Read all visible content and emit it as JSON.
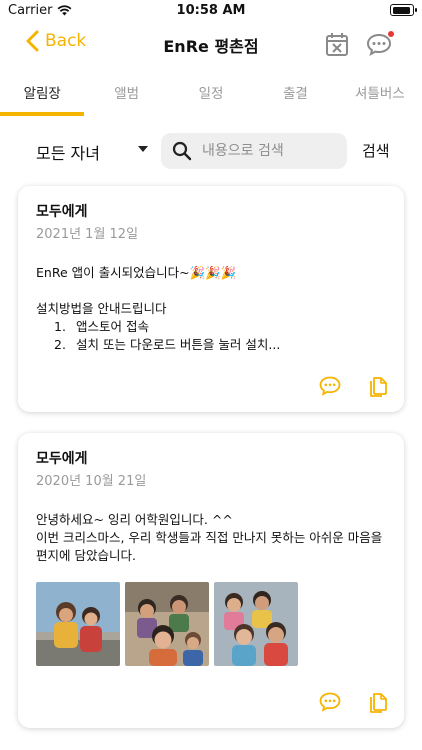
{
  "status_bar": {
    "carrier": "Carrier",
    "time": "10:58 AM",
    "battery_level": 0.95
  },
  "nav": {
    "back_label": "Back",
    "title": "EnRe 평촌점",
    "icons": [
      "calendar-x-icon",
      "chat-bubble-icon"
    ],
    "has_notification": true
  },
  "tabs": [
    {
      "label": "알림장",
      "active": true
    },
    {
      "label": "앨범",
      "active": false
    },
    {
      "label": "일정",
      "active": false
    },
    {
      "label": "출결",
      "active": false
    },
    {
      "label": "셔틀버스",
      "active": false
    }
  ],
  "filter": {
    "child_selected": "모든 자녀",
    "search_placeholder": "내용으로 검색",
    "search_button": "검색"
  },
  "notices": [
    {
      "to": "모두에게",
      "date": "2021년 1월 12일",
      "line1": "EnRe 앱이 출시되었습니다~🎉🎉🎉",
      "line2": "설치방법을 안내드립니다",
      "list": [
        {
          "num": "1.",
          "text": "앱스토어 접속"
        },
        {
          "num": "2.",
          "text": "설치 또는 다운로드 버튼을 눌러 설치..."
        }
      ]
    },
    {
      "to": "모두에게",
      "date": "2020년 10월 21일",
      "line1": "안녕하세요~ 잉리 어학원입니다. ^^",
      "line2": "이번 크리스마스, 우리 학생들과 직접 만나지 못하는 아쉬운 마음을 편지에 담았습니다.",
      "photo_count": 3
    }
  ],
  "colors": {
    "accent": "#F5B400",
    "muted": "#9a9a9a",
    "badge": "#e53935",
    "search_bg": "#efefef"
  }
}
